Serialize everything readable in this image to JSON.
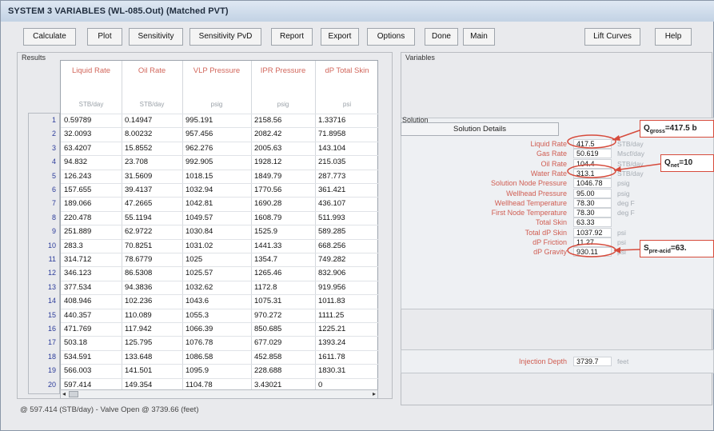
{
  "window": {
    "title": "SYSTEM 3 VARIABLES (WL-085.Out) (Matched PVT)"
  },
  "toolbar": {
    "buttons": [
      "Calculate",
      "Plot",
      "Sensitivity",
      "Sensitivity PvD",
      "Report",
      "Export",
      "Options",
      "Done",
      "Main",
      "Lift Curves",
      "Help"
    ]
  },
  "results": {
    "title": "Results",
    "columns": [
      {
        "label": "Liquid Rate",
        "unit": "STB/day"
      },
      {
        "label": "Oil Rate",
        "unit": "STB/day"
      },
      {
        "label": "VLP Pressure",
        "unit": "psig"
      },
      {
        "label": "IPR Pressure",
        "unit": "psig"
      },
      {
        "label": "dP Total Skin",
        "unit": "psi"
      }
    ],
    "rows": [
      [
        "0.59789",
        "0.14947",
        "995.191",
        "2158.56",
        "1.33716"
      ],
      [
        "32.0093",
        "8.00232",
        "957.456",
        "2082.42",
        "71.8958"
      ],
      [
        "63.4207",
        "15.8552",
        "962.276",
        "2005.63",
        "143.104"
      ],
      [
        "94.832",
        "23.708",
        "992.905",
        "1928.12",
        "215.035"
      ],
      [
        "126.243",
        "31.5609",
        "1018.15",
        "1849.79",
        "287.773"
      ],
      [
        "157.655",
        "39.4137",
        "1032.94",
        "1770.56",
        "361.421"
      ],
      [
        "189.066",
        "47.2665",
        "1042.81",
        "1690.28",
        "436.107"
      ],
      [
        "220.478",
        "55.1194",
        "1049.57",
        "1608.79",
        "511.993"
      ],
      [
        "251.889",
        "62.9722",
        "1030.84",
        "1525.9",
        "589.285"
      ],
      [
        "283.3",
        "70.8251",
        "1031.02",
        "1441.33",
        "668.256"
      ],
      [
        "314.712",
        "78.6779",
        "1025",
        "1354.7",
        "749.282"
      ],
      [
        "346.123",
        "86.5308",
        "1025.57",
        "1265.46",
        "832.906"
      ],
      [
        "377.534",
        "94.3836",
        "1032.62",
        "1172.8",
        "919.956"
      ],
      [
        "408.946",
        "102.236",
        "1043.6",
        "1075.31",
        "1011.83"
      ],
      [
        "440.357",
        "110.089",
        "1055.3",
        "970.272",
        "1111.25"
      ],
      [
        "471.769",
        "117.942",
        "1066.39",
        "850.685",
        "1225.21"
      ],
      [
        "503.18",
        "125.795",
        "1076.78",
        "677.029",
        "1393.24"
      ],
      [
        "534.591",
        "133.648",
        "1086.58",
        "452.858",
        "1611.78"
      ],
      [
        "566.003",
        "141.501",
        "1095.9",
        "228.688",
        "1830.31"
      ],
      [
        "597.414",
        "149.354",
        "1104.78",
        "3.43021",
        "0"
      ]
    ]
  },
  "status": {
    "text": "@ 597.414 (STB/day) - Valve Open @ 3739.66 (feet)"
  },
  "variables": {
    "title": "Variables",
    "solution_title": "Solution",
    "solution_tab": "Solution Details",
    "items": [
      {
        "label": "Liquid Rate",
        "value": "417.5",
        "unit": "STB/day"
      },
      {
        "label": "Gas Rate",
        "value": "50.619",
        "unit": "Mscf/day"
      },
      {
        "label": "Oil Rate",
        "value": "104.4",
        "unit": "STB/day"
      },
      {
        "label": "Water Rate",
        "value": "313.1",
        "unit": "STB/day"
      },
      {
        "label": "Solution Node Pressure",
        "value": "1046.78",
        "unit": "psig"
      },
      {
        "label": "Wellhead Pressure",
        "value": "95.00",
        "unit": "psig"
      },
      {
        "label": "Wellhead Temperature",
        "value": "78.30",
        "unit": "deg F"
      },
      {
        "label": "First Node Temperature",
        "value": "78.30",
        "unit": "deg F"
      },
      {
        "label": "Total Skin",
        "value": "63.33",
        "unit": ""
      },
      {
        "label": "Total dP Skin",
        "value": "1037.92",
        "unit": "psi"
      },
      {
        "label": "dP Friction",
        "value": "11.27",
        "unit": "psi"
      },
      {
        "label": "dP Gravity",
        "value": "930.11",
        "unit": "psi"
      }
    ],
    "injection": {
      "label": "Injection Depth",
      "value": "3739.7",
      "unit": "feet"
    }
  },
  "annotations": {
    "callout_1": "Q",
    "callout_1_sub": "gross",
    "callout_1_rest": "=417.5 b",
    "callout_2": "Q",
    "callout_2_sub": "net",
    "callout_2_rest": "=10",
    "callout_3": "S",
    "callout_3_sub": "pre-acid",
    "callout_3_rest": "=63.",
    "color": "#d64b3c"
  }
}
